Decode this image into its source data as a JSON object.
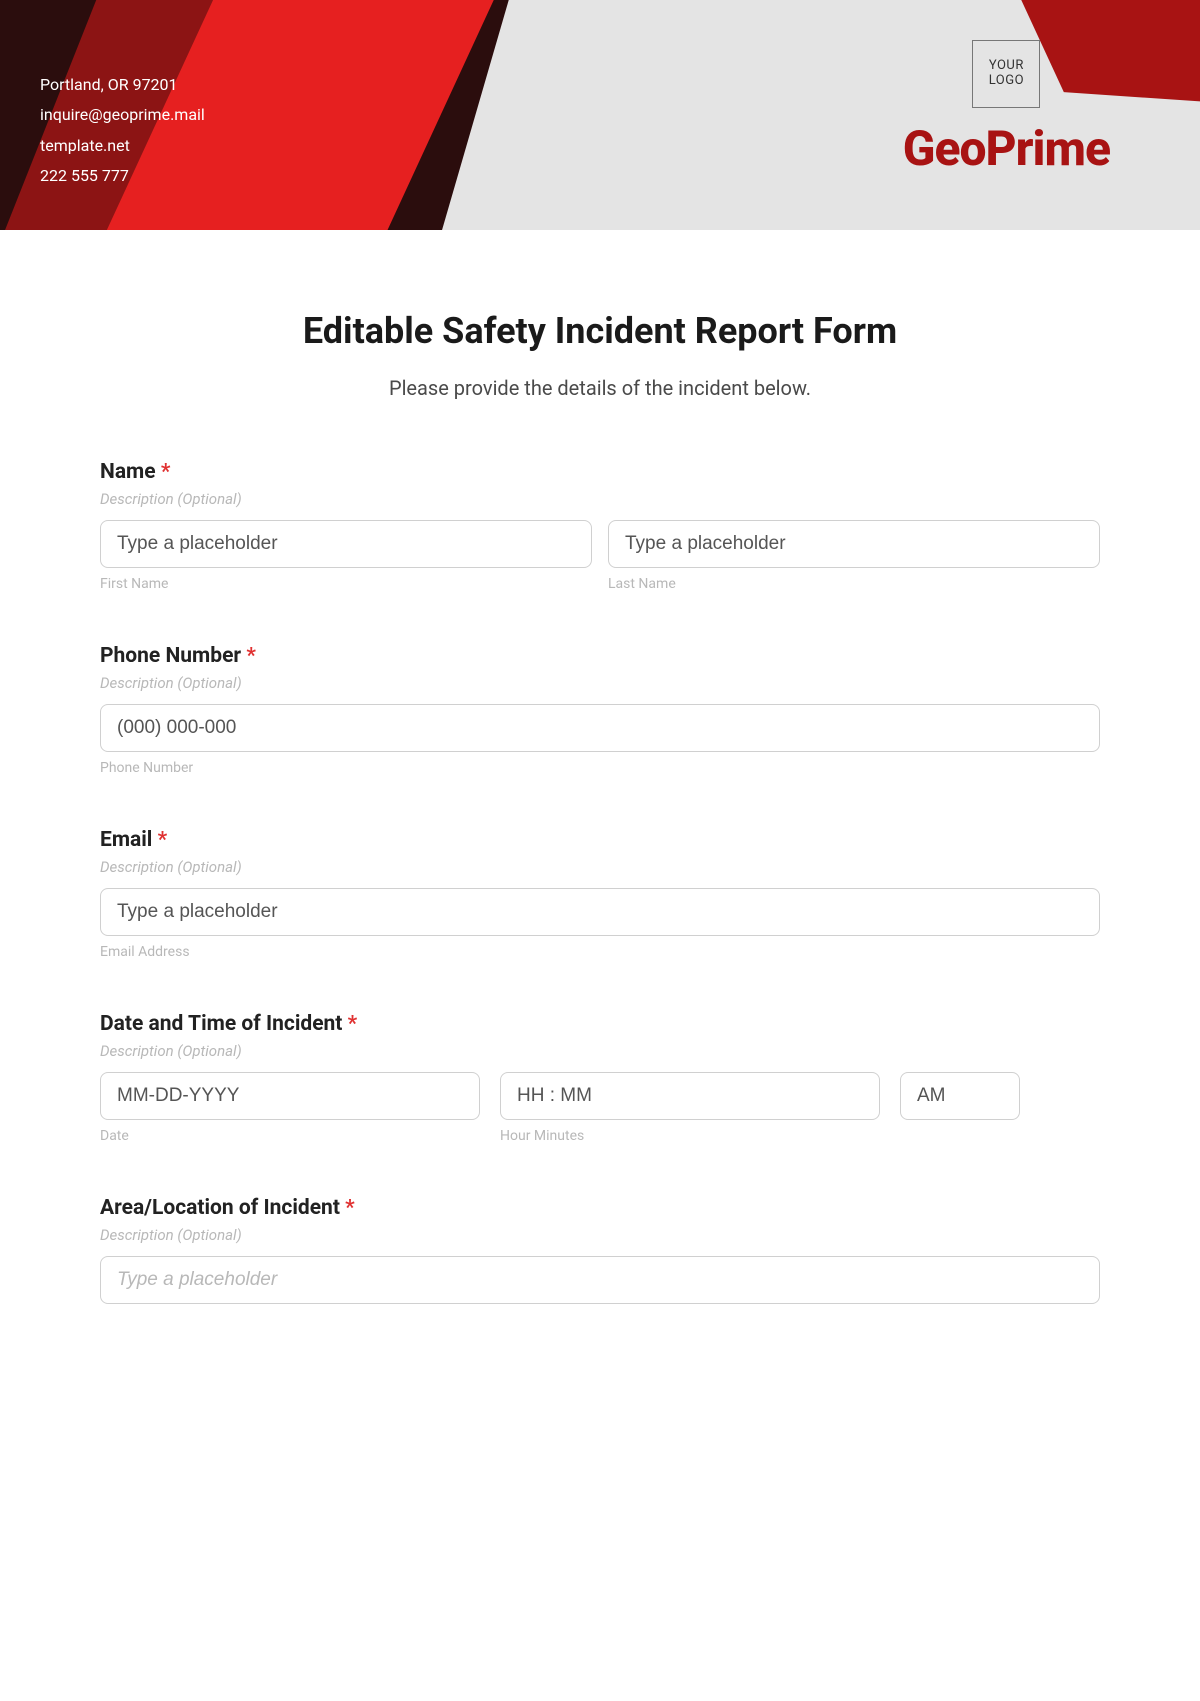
{
  "header": {
    "contact": {
      "line1": "Portland, OR 97201",
      "line2": "inquire@geoprime.mail",
      "line3": "template.net",
      "line4": "222 555 777"
    },
    "logo_line1": "YOUR",
    "logo_line2": "LOGO",
    "brand": "GeoPrime"
  },
  "form": {
    "title": "Editable Safety Incident Report Form",
    "subtitle": "Please provide the details of the incident below.",
    "desc_placeholder": "Description (Optional)",
    "name": {
      "label": "Name",
      "first_ph": "Type a placeholder",
      "last_ph": "Type a placeholder",
      "first_sub": "First Name",
      "last_sub": "Last Name"
    },
    "phone": {
      "label": "Phone Number",
      "ph": "(000) 000-000",
      "sub": "Phone Number"
    },
    "email": {
      "label": "Email",
      "ph": "Type a placeholder",
      "sub": "Email Address"
    },
    "datetime": {
      "label": "Date and Time of Incident",
      "date_ph": "MM-DD-YYYY",
      "time_ph": "HH : MM",
      "ampm_ph": "AM",
      "date_sub": "Date",
      "time_sub": "Hour Minutes"
    },
    "area": {
      "label": "Area/Location of Incident",
      "ph": "Type a placeholder"
    }
  }
}
